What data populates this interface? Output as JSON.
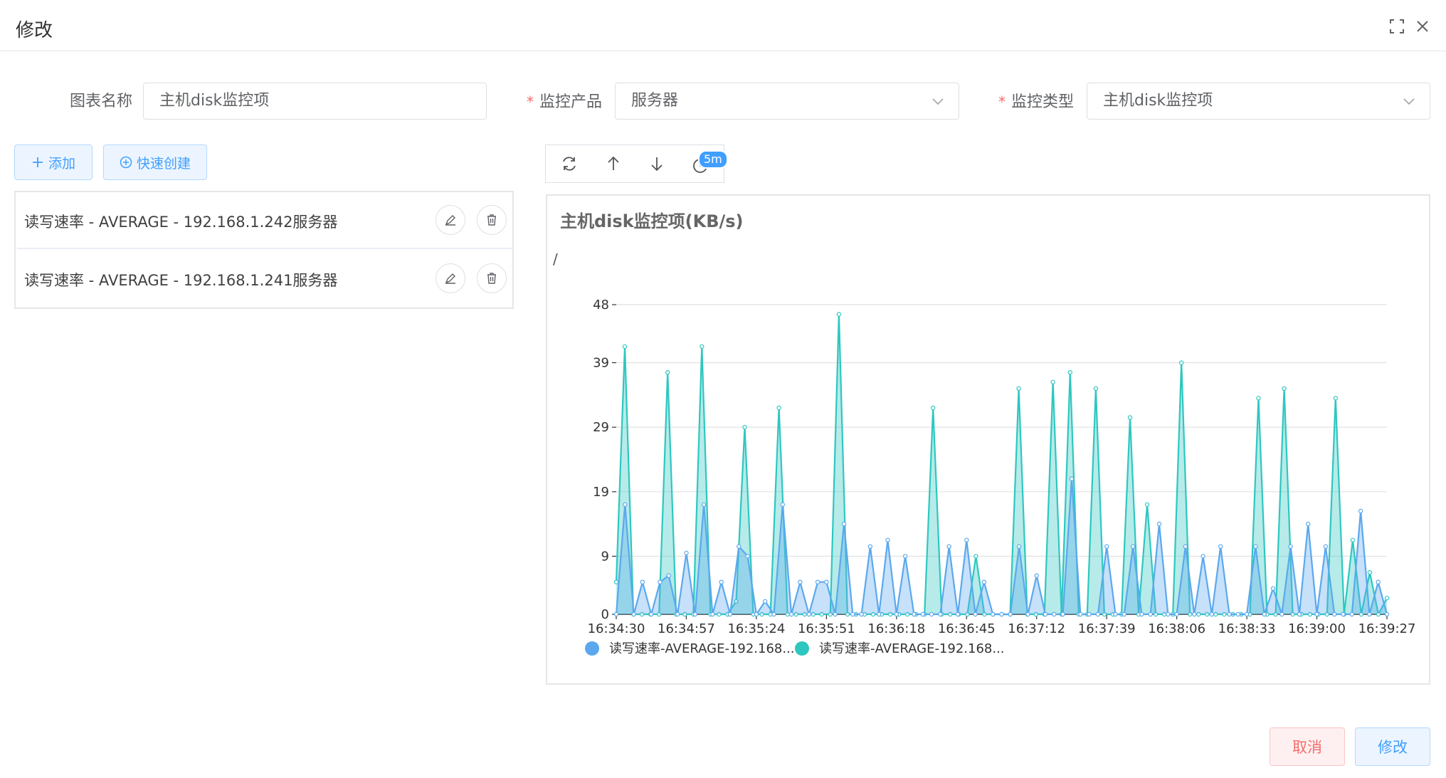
{
  "dialog": {
    "title": "修改"
  },
  "form": {
    "chart_name_label": "图表名称",
    "chart_name_value": "主机disk监控项",
    "product_label": "监控产品",
    "product_value": "服务器",
    "type_label": "监控类型",
    "type_value": "主机disk监控项",
    "required_mark": "*"
  },
  "actions": {
    "add_label": "添加",
    "quick_create_label": "快速创建"
  },
  "list": {
    "items": [
      {
        "label": "读写速率 - AVERAGE - 192.168.1.242服务器"
      },
      {
        "label": "读写速率 - AVERAGE - 192.168.1.241服务器"
      }
    ]
  },
  "toolbar": {
    "time_range_badge": "5m"
  },
  "footer": {
    "cancel_label": "取消",
    "submit_label": "修改"
  },
  "colors": {
    "primary": "#409eff",
    "danger": "#f56c6c",
    "series1": "#5ba8ee",
    "series2": "#2ec7c0"
  },
  "icons": [
    "fullscreen-icon",
    "close-icon",
    "chevron-down-icon",
    "plus-icon",
    "circle-plus-icon",
    "edit-icon",
    "delete-icon",
    "refresh-icon",
    "arrow-up-icon",
    "arrow-down-icon",
    "clock-icon"
  ],
  "chart_data": {
    "type": "area",
    "title": "主机disk监控项(KB/s)",
    "ylabel": "/",
    "xlabel": "",
    "ylim": [
      0,
      48
    ],
    "yticks": [
      "0",
      "9",
      "19",
      "29",
      "39",
      "48"
    ],
    "xticks": [
      "16:34:30",
      "16:34:57",
      "16:35:24",
      "16:35:51",
      "16:36:18",
      "16:36:45",
      "16:37:12",
      "16:37:39",
      "16:38:06",
      "16:38:33",
      "16:39:00",
      "16:39:27"
    ],
    "grid": true,
    "legend_position": "bottom-left",
    "series": [
      {
        "name": "读写速率-AVERAGE-192.168...",
        "values": [
          0,
          17,
          0,
          5,
          0,
          5,
          6,
          0,
          9.5,
          0,
          17,
          0,
          5,
          0,
          10.5,
          9,
          0,
          2,
          0,
          17,
          0,
          5,
          0,
          5,
          5,
          0,
          14,
          0,
          0,
          10.5,
          0,
          11.5,
          0,
          9,
          0,
          0,
          0,
          0,
          10.5,
          0,
          11.5,
          0,
          5,
          0,
          0,
          0,
          10.5,
          0,
          6,
          0,
          0,
          0,
          21,
          0,
          0,
          0,
          10.5,
          0,
          0,
          10.5,
          0,
          0,
          14,
          0,
          0,
          10.5,
          0,
          9,
          0,
          10.5,
          0,
          0,
          0,
          10.5,
          0,
          4,
          0,
          10.5,
          0,
          14,
          0,
          10.5,
          0,
          0,
          0,
          16,
          0,
          5,
          0
        ]
      },
      {
        "name": "读写速率-AVERAGE-192.168...",
        "values": [
          5,
          41.5,
          0,
          0,
          0,
          0,
          37.5,
          0,
          0,
          0,
          41.5,
          0,
          0,
          0,
          2,
          29,
          0,
          0,
          0,
          32,
          0,
          0,
          0,
          0,
          0,
          0,
          46.5,
          0,
          0,
          0,
          0,
          0,
          0,
          0,
          0,
          0,
          0,
          32,
          0,
          0,
          0,
          0,
          9,
          0,
          0,
          0,
          0,
          35,
          0,
          0,
          0,
          36,
          0,
          37.5,
          0,
          0,
          35,
          0,
          0,
          0,
          30.5,
          0,
          17,
          0,
          0,
          0,
          39,
          0,
          0,
          0,
          0,
          0,
          0,
          0,
          0,
          33.5,
          0,
          0,
          35,
          0,
          0,
          0,
          0,
          0,
          33.5,
          0,
          11.5,
          0,
          6.5,
          0,
          2.5
        ]
      }
    ]
  }
}
